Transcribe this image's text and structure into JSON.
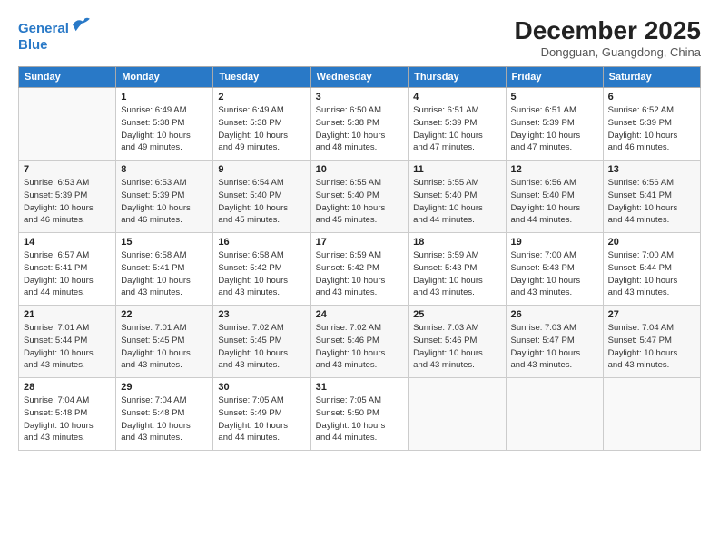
{
  "header": {
    "logo_line1": "General",
    "logo_line2": "Blue",
    "month": "December 2025",
    "location": "Dongguan, Guangdong, China"
  },
  "weekdays": [
    "Sunday",
    "Monday",
    "Tuesday",
    "Wednesday",
    "Thursday",
    "Friday",
    "Saturday"
  ],
  "weeks": [
    [
      {
        "day": "",
        "detail": ""
      },
      {
        "day": "1",
        "detail": "Sunrise: 6:49 AM\nSunset: 5:38 PM\nDaylight: 10 hours\nand 49 minutes."
      },
      {
        "day": "2",
        "detail": "Sunrise: 6:49 AM\nSunset: 5:38 PM\nDaylight: 10 hours\nand 49 minutes."
      },
      {
        "day": "3",
        "detail": "Sunrise: 6:50 AM\nSunset: 5:38 PM\nDaylight: 10 hours\nand 48 minutes."
      },
      {
        "day": "4",
        "detail": "Sunrise: 6:51 AM\nSunset: 5:39 PM\nDaylight: 10 hours\nand 47 minutes."
      },
      {
        "day": "5",
        "detail": "Sunrise: 6:51 AM\nSunset: 5:39 PM\nDaylight: 10 hours\nand 47 minutes."
      },
      {
        "day": "6",
        "detail": "Sunrise: 6:52 AM\nSunset: 5:39 PM\nDaylight: 10 hours\nand 46 minutes."
      }
    ],
    [
      {
        "day": "7",
        "detail": "Sunrise: 6:53 AM\nSunset: 5:39 PM\nDaylight: 10 hours\nand 46 minutes."
      },
      {
        "day": "8",
        "detail": "Sunrise: 6:53 AM\nSunset: 5:39 PM\nDaylight: 10 hours\nand 46 minutes."
      },
      {
        "day": "9",
        "detail": "Sunrise: 6:54 AM\nSunset: 5:40 PM\nDaylight: 10 hours\nand 45 minutes."
      },
      {
        "day": "10",
        "detail": "Sunrise: 6:55 AM\nSunset: 5:40 PM\nDaylight: 10 hours\nand 45 minutes."
      },
      {
        "day": "11",
        "detail": "Sunrise: 6:55 AM\nSunset: 5:40 PM\nDaylight: 10 hours\nand 44 minutes."
      },
      {
        "day": "12",
        "detail": "Sunrise: 6:56 AM\nSunset: 5:40 PM\nDaylight: 10 hours\nand 44 minutes."
      },
      {
        "day": "13",
        "detail": "Sunrise: 6:56 AM\nSunset: 5:41 PM\nDaylight: 10 hours\nand 44 minutes."
      }
    ],
    [
      {
        "day": "14",
        "detail": "Sunrise: 6:57 AM\nSunset: 5:41 PM\nDaylight: 10 hours\nand 44 minutes."
      },
      {
        "day": "15",
        "detail": "Sunrise: 6:58 AM\nSunset: 5:41 PM\nDaylight: 10 hours\nand 43 minutes."
      },
      {
        "day": "16",
        "detail": "Sunrise: 6:58 AM\nSunset: 5:42 PM\nDaylight: 10 hours\nand 43 minutes."
      },
      {
        "day": "17",
        "detail": "Sunrise: 6:59 AM\nSunset: 5:42 PM\nDaylight: 10 hours\nand 43 minutes."
      },
      {
        "day": "18",
        "detail": "Sunrise: 6:59 AM\nSunset: 5:43 PM\nDaylight: 10 hours\nand 43 minutes."
      },
      {
        "day": "19",
        "detail": "Sunrise: 7:00 AM\nSunset: 5:43 PM\nDaylight: 10 hours\nand 43 minutes."
      },
      {
        "day": "20",
        "detail": "Sunrise: 7:00 AM\nSunset: 5:44 PM\nDaylight: 10 hours\nand 43 minutes."
      }
    ],
    [
      {
        "day": "21",
        "detail": "Sunrise: 7:01 AM\nSunset: 5:44 PM\nDaylight: 10 hours\nand 43 minutes."
      },
      {
        "day": "22",
        "detail": "Sunrise: 7:01 AM\nSunset: 5:45 PM\nDaylight: 10 hours\nand 43 minutes."
      },
      {
        "day": "23",
        "detail": "Sunrise: 7:02 AM\nSunset: 5:45 PM\nDaylight: 10 hours\nand 43 minutes."
      },
      {
        "day": "24",
        "detail": "Sunrise: 7:02 AM\nSunset: 5:46 PM\nDaylight: 10 hours\nand 43 minutes."
      },
      {
        "day": "25",
        "detail": "Sunrise: 7:03 AM\nSunset: 5:46 PM\nDaylight: 10 hours\nand 43 minutes."
      },
      {
        "day": "26",
        "detail": "Sunrise: 7:03 AM\nSunset: 5:47 PM\nDaylight: 10 hours\nand 43 minutes."
      },
      {
        "day": "27",
        "detail": "Sunrise: 7:04 AM\nSunset: 5:47 PM\nDaylight: 10 hours\nand 43 minutes."
      }
    ],
    [
      {
        "day": "28",
        "detail": "Sunrise: 7:04 AM\nSunset: 5:48 PM\nDaylight: 10 hours\nand 43 minutes."
      },
      {
        "day": "29",
        "detail": "Sunrise: 7:04 AM\nSunset: 5:48 PM\nDaylight: 10 hours\nand 43 minutes."
      },
      {
        "day": "30",
        "detail": "Sunrise: 7:05 AM\nSunset: 5:49 PM\nDaylight: 10 hours\nand 44 minutes."
      },
      {
        "day": "31",
        "detail": "Sunrise: 7:05 AM\nSunset: 5:50 PM\nDaylight: 10 hours\nand 44 minutes."
      },
      {
        "day": "",
        "detail": ""
      },
      {
        "day": "",
        "detail": ""
      },
      {
        "day": "",
        "detail": ""
      }
    ]
  ]
}
